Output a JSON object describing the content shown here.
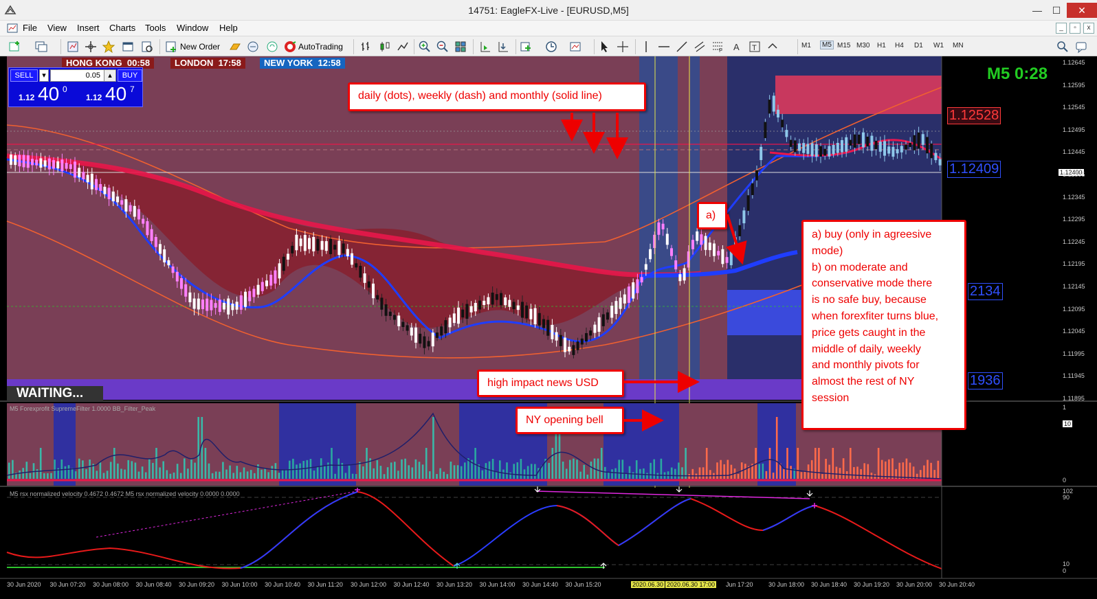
{
  "window": {
    "title": "14751: EagleFX-Live - [EURUSD,M5]",
    "minimize": "—",
    "maximize": "☐",
    "close": "✕"
  },
  "menu": {
    "items": [
      "File",
      "View",
      "Insert",
      "Charts",
      "Tools",
      "Window",
      "Help"
    ]
  },
  "toolbar": {
    "new_order": "New Order",
    "autotrading": "AutoTrading",
    "timeframes": [
      "M1",
      "M5",
      "M15",
      "M30",
      "H1",
      "H4",
      "D1",
      "W1",
      "MN"
    ],
    "active_timeframe": "M5"
  },
  "sessions": [
    {
      "name": "HONG KONG",
      "time": "00:58",
      "color": "#8a1a1a"
    },
    {
      "name": "LONDON",
      "time": "17:58",
      "color": "#8a1a1a"
    },
    {
      "name": "NEW YORK",
      "time": "12:58",
      "color": "#1565c0"
    }
  ],
  "trade_panel": {
    "sell": "SELL",
    "buy": "BUY",
    "lot": "0.05",
    "bid_small": "1.12",
    "bid_big": "40",
    "bid_sup": "0",
    "ask_small": "1.12",
    "ask_big": "40",
    "ask_sup": "7"
  },
  "timer": "M5 0:28",
  "waiting": "WAITING...",
  "price_labels": {
    "resistance": "1.12528",
    "current": "1.12409",
    "mid": "2134",
    "low": "1936",
    "current_tag": "1.12400"
  },
  "annotations": {
    "pivots": "daily (dots), weekly (dash) and monthly (solid line)",
    "a_marker": "a)",
    "news": "high impact news USD",
    "ny_bell": "NY opening bell",
    "explain": [
      "a) buy (only in agreesive",
      "mode)",
      "b) on moderate and",
      "conservative mode there",
      "is no safe buy, because",
      "when forexfiter turns blue,",
      "price gets caught in the",
      "middle of daily, weekly",
      "and monthly pivots for",
      "almost the rest of NY",
      "session"
    ]
  },
  "price_axis": [
    "1.12645",
    "1.12595",
    "1.12545",
    "1.12495",
    "1.12445",
    "1.12395",
    "1.12345",
    "1.12295",
    "1.12245",
    "1.12195",
    "1.12145",
    "1.12095",
    "1.12045",
    "1.11995",
    "1.11945",
    "1.11895"
  ],
  "indicator1": {
    "title": "M5 Forexprofit SupremeFilter 1.0000 BB_Filter_Peak",
    "axis": [
      "1",
      "10",
      "0"
    ]
  },
  "indicator2": {
    "title": "M5 rsx normalized velocity 0.4672 0.4672 M5 rsx normalized velocity 0.0000 0.0000",
    "axis": [
      "102",
      "90",
      "10",
      "0"
    ]
  },
  "time_axis": [
    "30 Jun 2020",
    "30 Jun 07:20",
    "30 Jun 08:00",
    "30 Jun 08:40",
    "30 Jun 09:20",
    "30 Jun 10:00",
    "30 Jun 10:40",
    "30 Jun 11:20",
    "30 Jun 12:00",
    "30 Jun 12:40",
    "30 Jun 13:20",
    "30 Jun 14:00",
    "30 Jun 14:40",
    "30 Jun 15:20",
    "2020.06.30",
    "2020.06.30 17:00",
    "Jun 17:20",
    "30 Jun 18:00",
    "30 Jun 18:40",
    "30 Jun 19:20",
    "30 Jun 20:00",
    "30 Jun 20:40"
  ],
  "colors": {
    "bg": "#000000",
    "bull": "#ffffff",
    "bear": "#ff80ff",
    "ma_red": "#e8174a",
    "ma_blue": "#1f3dff",
    "band_orange": "#f06030",
    "annot_red": "#ee0000"
  }
}
